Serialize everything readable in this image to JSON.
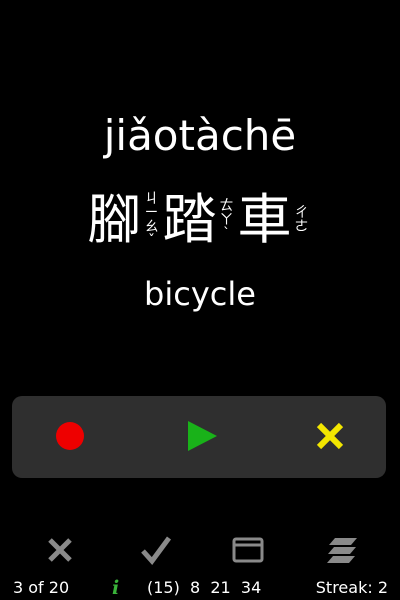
{
  "card": {
    "pinyin": "jiǎotàchē",
    "characters": [
      {
        "hanzi": "腳",
        "zhuyin": "ㄐㄧㄠˇ"
      },
      {
        "hanzi": "踏",
        "zhuyin": "ㄊㄚˋ"
      },
      {
        "hanzi": "車",
        "zhuyin": "ㄔㄜ"
      }
    ],
    "english": "bicycle"
  },
  "controls": {
    "record_icon": "record-icon",
    "play_icon": "play-icon",
    "delete_icon": "close-icon",
    "colors": {
      "record": "#ee0000",
      "play": "#19b219",
      "delete": "#f2e600",
      "panel": "#2f2f2f"
    }
  },
  "bottom_bar": {
    "icons": [
      "close-icon",
      "check-icon",
      "window-icon",
      "cards-stack-icon"
    ],
    "counter": "3 of 20",
    "info": "i",
    "stats": "(15)  8  21  34",
    "streak": "Streak: 2"
  }
}
